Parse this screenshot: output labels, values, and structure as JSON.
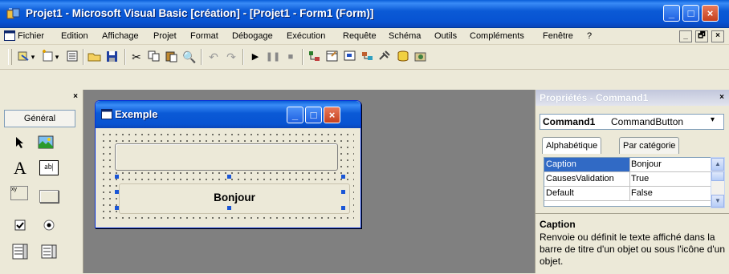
{
  "window": {
    "title": "Projet1 - Microsoft Visual Basic [création] - [Projet1 - Form1 (Form)]",
    "min": "_",
    "max": "□",
    "close": "×"
  },
  "menu": [
    "Fichier",
    "Edition",
    "Affichage",
    "Projet",
    "Format",
    "Débogage",
    "Exécution",
    "Requête",
    "Schéma",
    "Outils",
    "Compléments",
    "Fenêtre",
    "?"
  ],
  "mdi_controls": [
    "_",
    "🗗",
    "×"
  ],
  "toolbox": {
    "close": "×",
    "tab": "Général",
    "tools": [
      {
        "name": "pointer-tool",
        "glyph": "➤"
      },
      {
        "name": "picturebox-tool",
        "glyph": "🖼"
      },
      {
        "name": "label-tool",
        "glyph": "A"
      },
      {
        "name": "textbox-tool",
        "glyph": "ab|"
      },
      {
        "name": "frame-tool",
        "glyph": "xy"
      },
      {
        "name": "commandbutton-tool",
        "glyph": "▭"
      },
      {
        "name": "checkbox-tool",
        "glyph": "☑"
      },
      {
        "name": "optionbutton-tool",
        "glyph": "◉"
      },
      {
        "name": "combobox-tool",
        "glyph": "▤"
      },
      {
        "name": "listbox-tool",
        "glyph": "▦"
      }
    ]
  },
  "form": {
    "title": "Exemple",
    "button_caption": "Bonjour"
  },
  "properties": {
    "title": "Propriétés - Command1",
    "object_name": "Command1",
    "object_type": "CommandButton",
    "tabs": [
      "Alphabétique",
      "Par catégorie"
    ],
    "rows": [
      {
        "name": "Caption",
        "value": "Bonjour"
      },
      {
        "name": "CausesValidation",
        "value": "True"
      },
      {
        "name": "Default",
        "value": "False"
      }
    ],
    "desc_title": "Caption",
    "desc_text": "Renvoie ou définit le texte affiché dans la barre de titre d'un objet ou sous l'icône d'un objet.",
    "close": "×"
  },
  "colors": {
    "xp_blue": "#0a5fd8",
    "selection": "#316ac5",
    "chrome": "#ece9d8"
  }
}
